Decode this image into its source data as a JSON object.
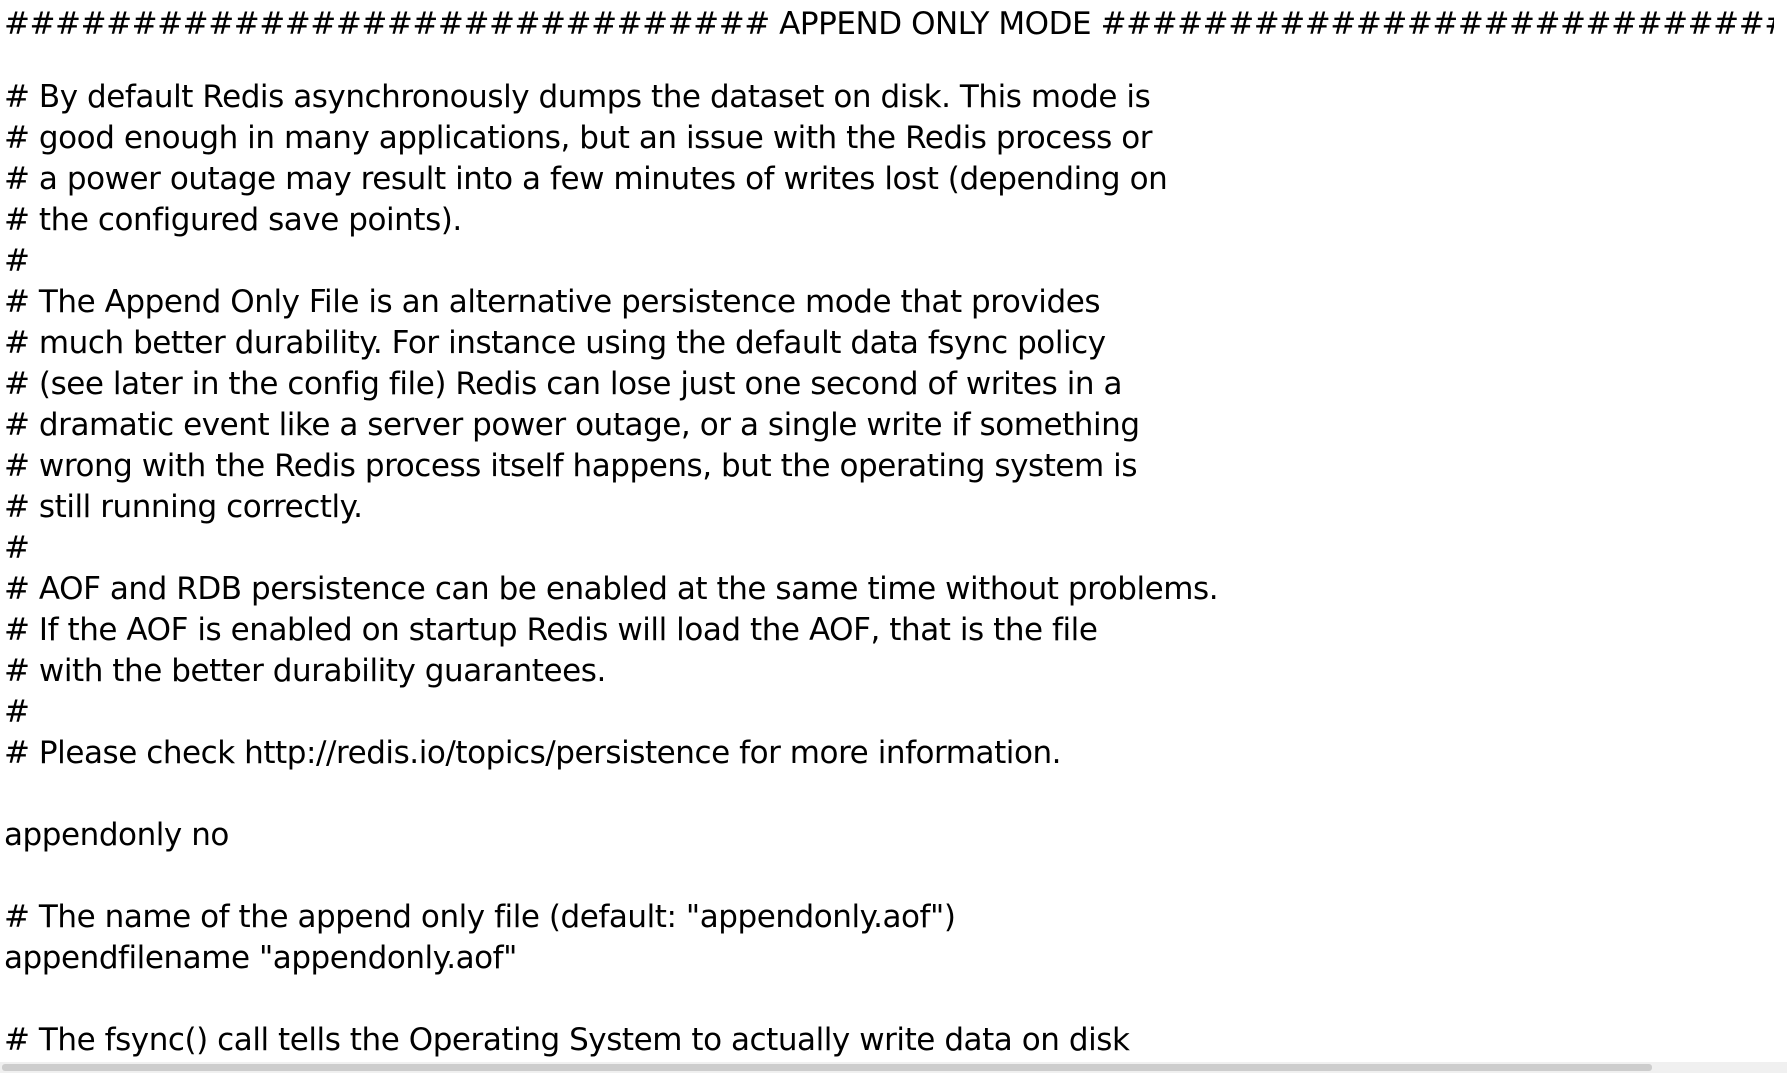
{
  "document": {
    "lines": [
      "############################## APPEND ONLY MODE ###############################",
      "",
      "# By default Redis asynchronously dumps the dataset on disk. This mode is",
      "# good enough in many applications, but an issue with the Redis process or",
      "# a power outage may result into a few minutes of writes lost (depending on",
      "# the configured save points).",
      "#",
      "# The Append Only File is an alternative persistence mode that provides",
      "# much better durability. For instance using the default data fsync policy",
      "# (see later in the config file) Redis can lose just one second of writes in a",
      "# dramatic event like a server power outage, or a single write if something",
      "# wrong with the Redis process itself happens, but the operating system is",
      "# still running correctly.",
      "#",
      "# AOF and RDB persistence can be enabled at the same time without problems.",
      "# If the AOF is enabled on startup Redis will load the AOF, that is the file",
      "# with the better durability guarantees.",
      "#",
      "# Please check http://redis.io/topics/persistence for more information.",
      "",
      "appendonly no",
      "",
      "# The name of the append only file (default: \"appendonly.aof\")",
      "appendfilename \"appendonly.aof\"",
      "",
      "# The fsync() call tells the Operating System to actually write data on disk"
    ]
  }
}
